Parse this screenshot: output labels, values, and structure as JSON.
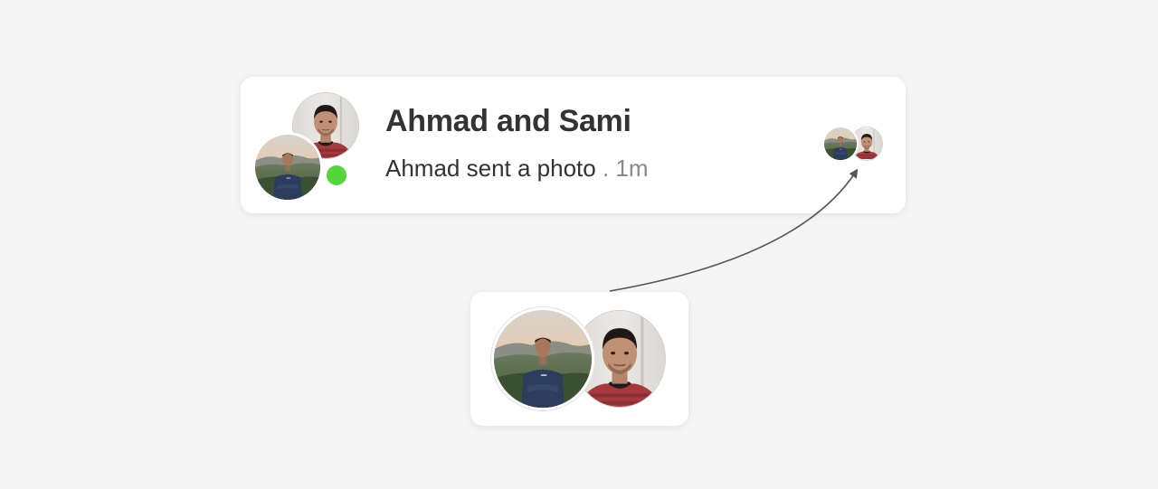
{
  "conversation": {
    "title": "Ahmad and Sami",
    "preview_message": "Ahmad sent a photo",
    "separator": ".",
    "timestamp": "1m",
    "online_status_color": "#51d73a"
  },
  "icons": {
    "group_avatar": "group-avatar-icon",
    "online_indicator": "online-dot-icon",
    "seen_indicator": "seen-heads-icon"
  },
  "colors": {
    "background": "#f5f5f5",
    "card": "#ffffff",
    "title_text": "#333333",
    "muted_text": "#8a8a8a",
    "arrow": "#555555"
  }
}
